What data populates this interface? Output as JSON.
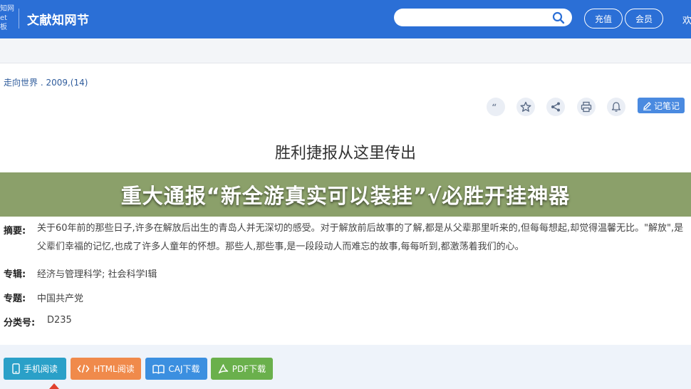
{
  "header": {
    "logo_lines": [
      "知网",
      "et",
      "板"
    ],
    "site_title": "文献知网节",
    "search": {
      "value": "",
      "placeholder": ""
    },
    "buttons": {
      "recharge": "充值",
      "member": "会员"
    },
    "more_label": "欢"
  },
  "article": {
    "source": "走向世界 . 2009,(14)",
    "title": "胜利捷报从这里传出",
    "tools": [
      "quote-icon",
      "star-icon",
      "share-icon",
      "print-icon",
      "bell-icon"
    ],
    "note_button": "记笔记"
  },
  "overlay": {
    "text": "重大通报“新全游真实可以装挂”√必胜开挂神器"
  },
  "meta": {
    "abstract_label": "摘要:",
    "abstract_text": "关于60年前的那些日子,许多在解放后出生的青岛人并无深切的感受。对于解放前后故事的了解,都是从父辈那里听来的,但每每想起,却觉得温馨无比。\"解放\",是父辈们幸福的记忆,也成了许多人童年的怀想。那些人,那些事,是一段段动人而难忘的故事,每每听到,都激荡着我们的心。",
    "series_label": "专辑:",
    "series_value": "经济与管理科学; 社会科学Ⅰ辑",
    "topic_label": "专题:",
    "topic_value": "中国共产党",
    "class_label": "分类号:",
    "class_value": "D235"
  },
  "downloads": {
    "phone": "手机阅读",
    "html": "HTML阅读",
    "caj": "CAJ下载",
    "pdf": "PDF下载"
  },
  "colors": {
    "header_bg": "#2b6fd6",
    "overlay_bg": "#8ba06a",
    "phone_btn": "#2aa0c8",
    "html_btn": "#f08a4b",
    "caj_btn": "#3b8fe0",
    "pdf_btn": "#6ab04c",
    "note_btn": "#4a8ae0"
  }
}
